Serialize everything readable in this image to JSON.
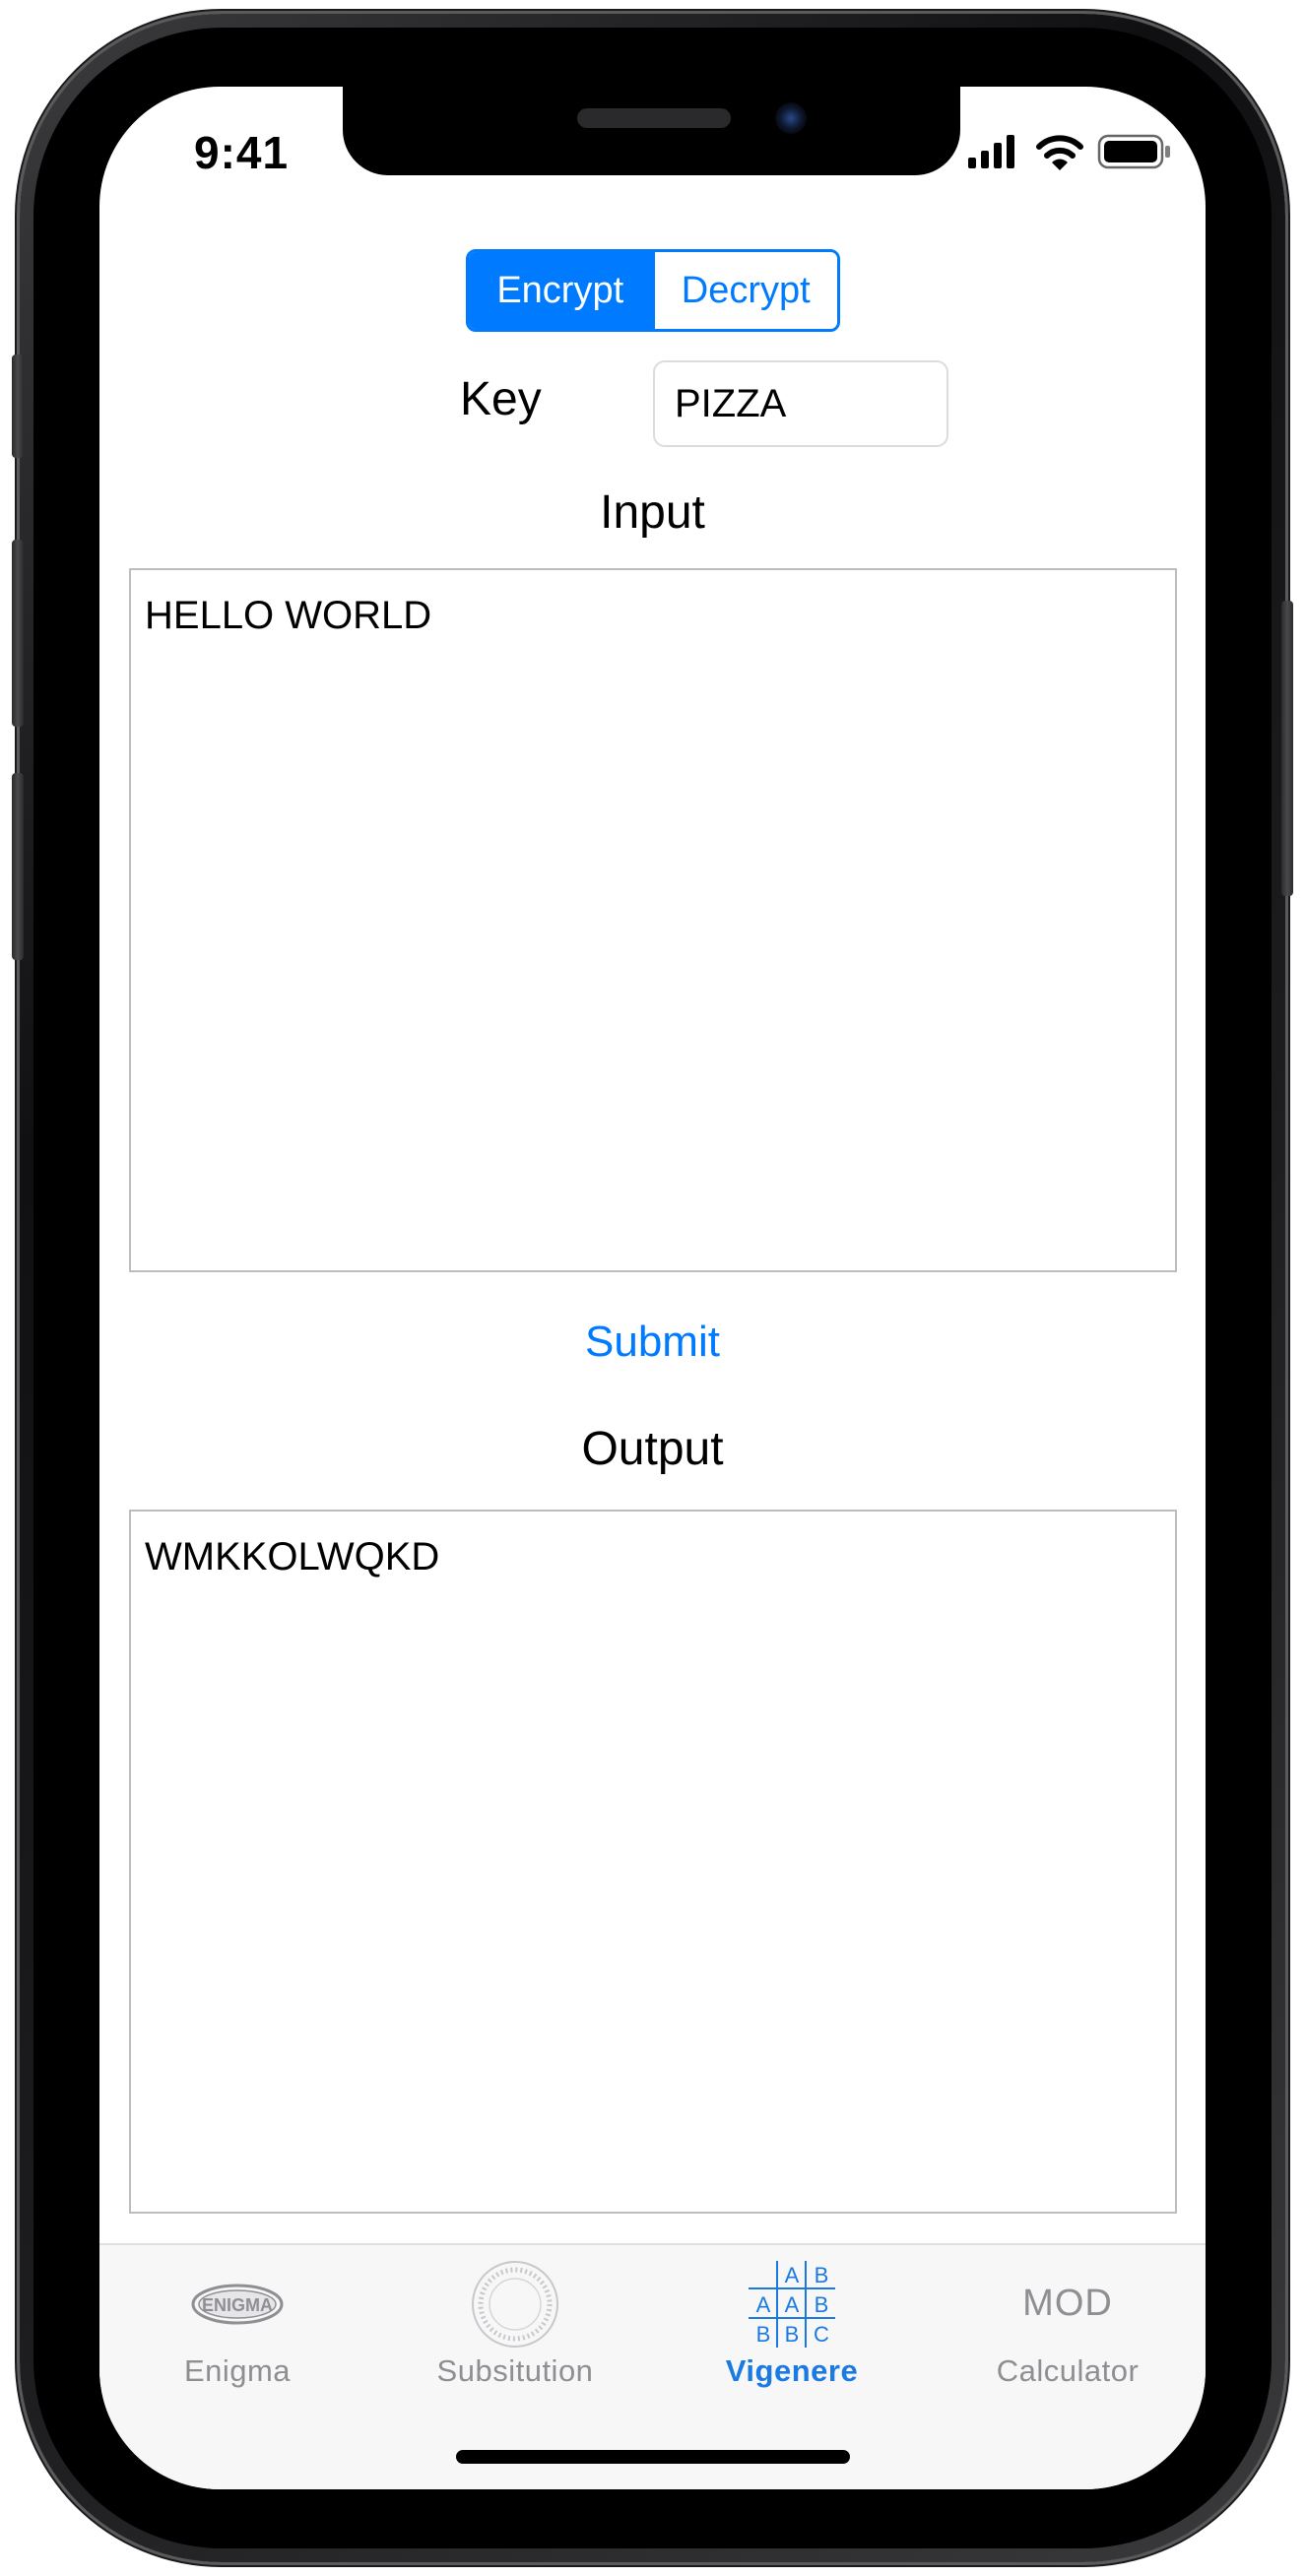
{
  "status_bar": {
    "time": "9:41"
  },
  "mode_control": {
    "options": [
      "Encrypt",
      "Decrypt"
    ],
    "selected": "Encrypt"
  },
  "key": {
    "label": "Key",
    "value": "PIZZA"
  },
  "input": {
    "title": "Input",
    "value": "HELLO WORLD"
  },
  "submit_label": "Submit",
  "output": {
    "title": "Output",
    "value": "WMKKOLWQKD"
  },
  "tab_bar": {
    "selected_index": 2,
    "accent_color": "#1b7ae2",
    "inactive_color": "#8e8e93",
    "tabs": [
      {
        "label": "Enigma",
        "icon": "enigma-logo-icon",
        "icon_text": "ENIGMA"
      },
      {
        "label": "Subsitution",
        "icon": "cipher-wheel-icon"
      },
      {
        "label": "Vigenere",
        "icon": "vigenere-table-icon",
        "icon_cells": [
          "A",
          "B",
          "A",
          "A",
          "B",
          "B",
          "B",
          "C"
        ]
      },
      {
        "label": "Calculator",
        "icon": "mod-icon",
        "icon_text": "MOD"
      }
    ]
  },
  "colors": {
    "accent": "#007aff",
    "border": "#bdbdbd"
  }
}
